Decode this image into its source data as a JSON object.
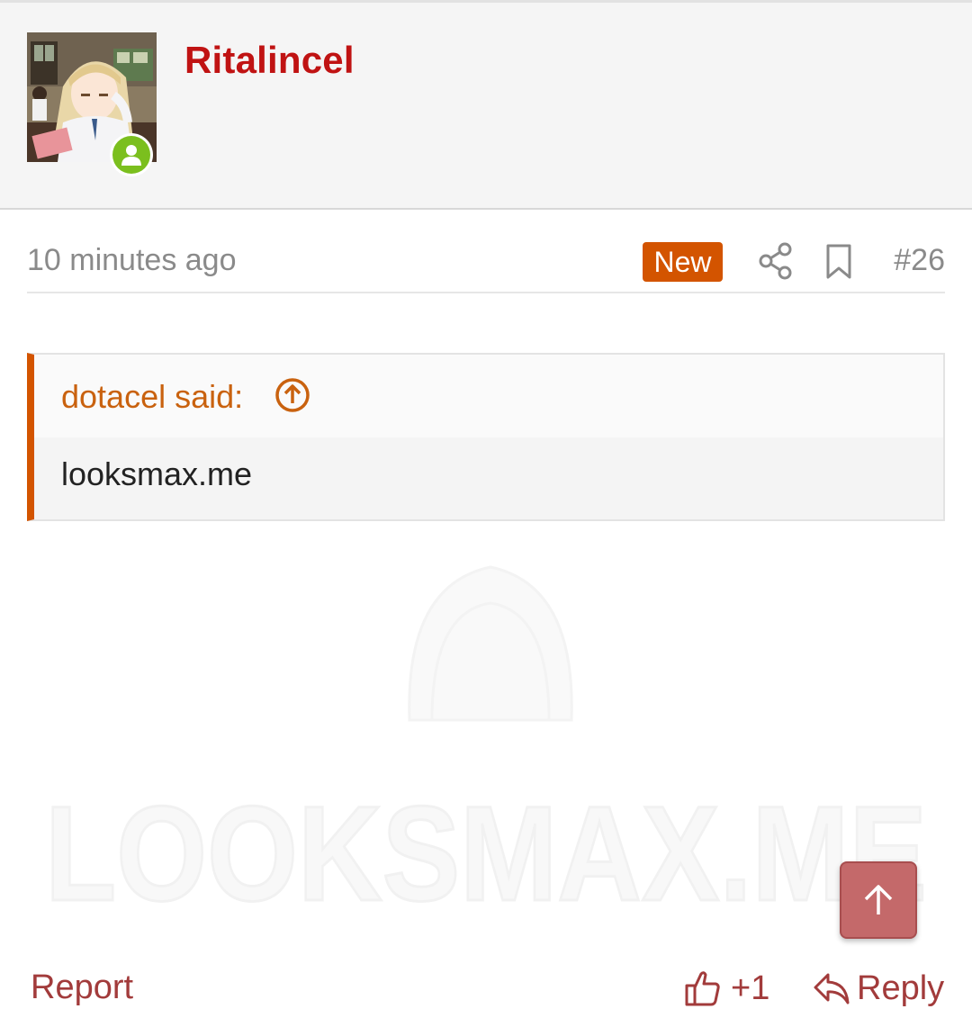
{
  "post": {
    "username": "Ritalincel",
    "time": "10 minutes ago",
    "new_badge": "New",
    "post_number": "#26"
  },
  "quote": {
    "author_line": "dotacel said:",
    "text": "looksmax.me"
  },
  "watermark": "LOOKSMAX.ME",
  "actions": {
    "report": "Report",
    "like_count": "+1",
    "reply": "Reply"
  },
  "icons": {
    "share": "share-icon",
    "bookmark": "bookmark-icon",
    "quote_jump": "arrow-up-circle-icon",
    "scroll_top": "arrow-up-icon",
    "like": "thumbs-up-icon",
    "reply": "reply-arrow-icon",
    "online": "user-online-icon"
  },
  "colors": {
    "username": "#c01313",
    "accent": "#d35400",
    "link": "#a23b3b",
    "online": "#7bbf1e",
    "scroll_top_bg": "#c4696a"
  }
}
